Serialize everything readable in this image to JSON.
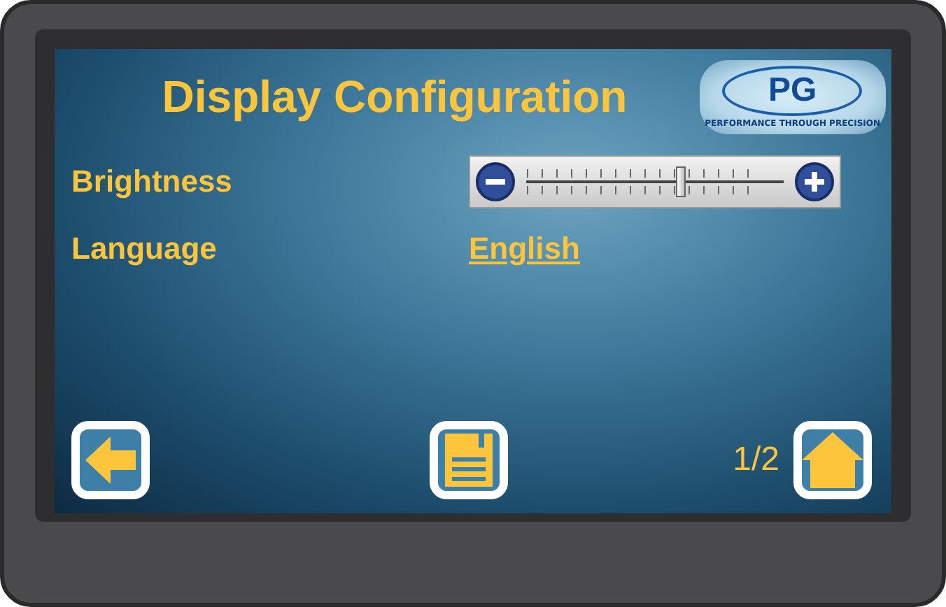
{
  "screen": {
    "title": "Display Configuration"
  },
  "logo": {
    "text": "PG",
    "tagline": "PERFORMANCE THROUGH PRECISION"
  },
  "settings": [
    {
      "kind": "slider",
      "label": "Brightness",
      "level": 0.6
    },
    {
      "kind": "link",
      "label": "Language",
      "value": "English"
    }
  ],
  "footer": {
    "page": "1/2"
  }
}
